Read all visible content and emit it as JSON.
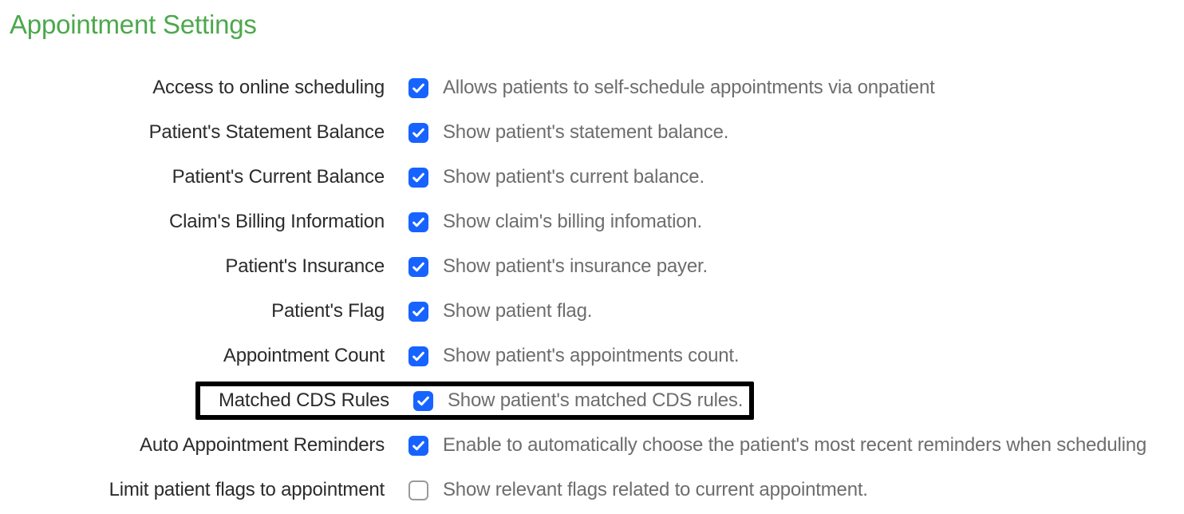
{
  "title": "Appointment Settings",
  "settings": [
    {
      "label": "Access to online scheduling",
      "checked": true,
      "desc": "Allows patients to self-schedule appointments via onpatient"
    },
    {
      "label": "Patient's Statement Balance",
      "checked": true,
      "desc": "Show patient's statement balance."
    },
    {
      "label": "Patient's Current Balance",
      "checked": true,
      "desc": "Show patient's current balance."
    },
    {
      "label": "Claim's Billing Information",
      "checked": true,
      "desc": "Show claim's billing infomation."
    },
    {
      "label": "Patient's Insurance",
      "checked": true,
      "desc": "Show patient's insurance payer."
    },
    {
      "label": "Patient's Flag",
      "checked": true,
      "desc": "Show patient flag."
    },
    {
      "label": "Appointment Count",
      "checked": true,
      "desc": "Show patient's appointments count."
    },
    {
      "label": "Matched CDS Rules",
      "checked": true,
      "desc": "Show patient's matched CDS rules."
    },
    {
      "label": "Auto Appointment Reminders",
      "checked": true,
      "desc": "Enable to automatically choose the patient's most recent reminders when scheduling"
    },
    {
      "label": "Limit patient flags to appointment",
      "checked": false,
      "desc": "Show relevant flags related to current appointment."
    }
  ],
  "highlighted_index": 7
}
